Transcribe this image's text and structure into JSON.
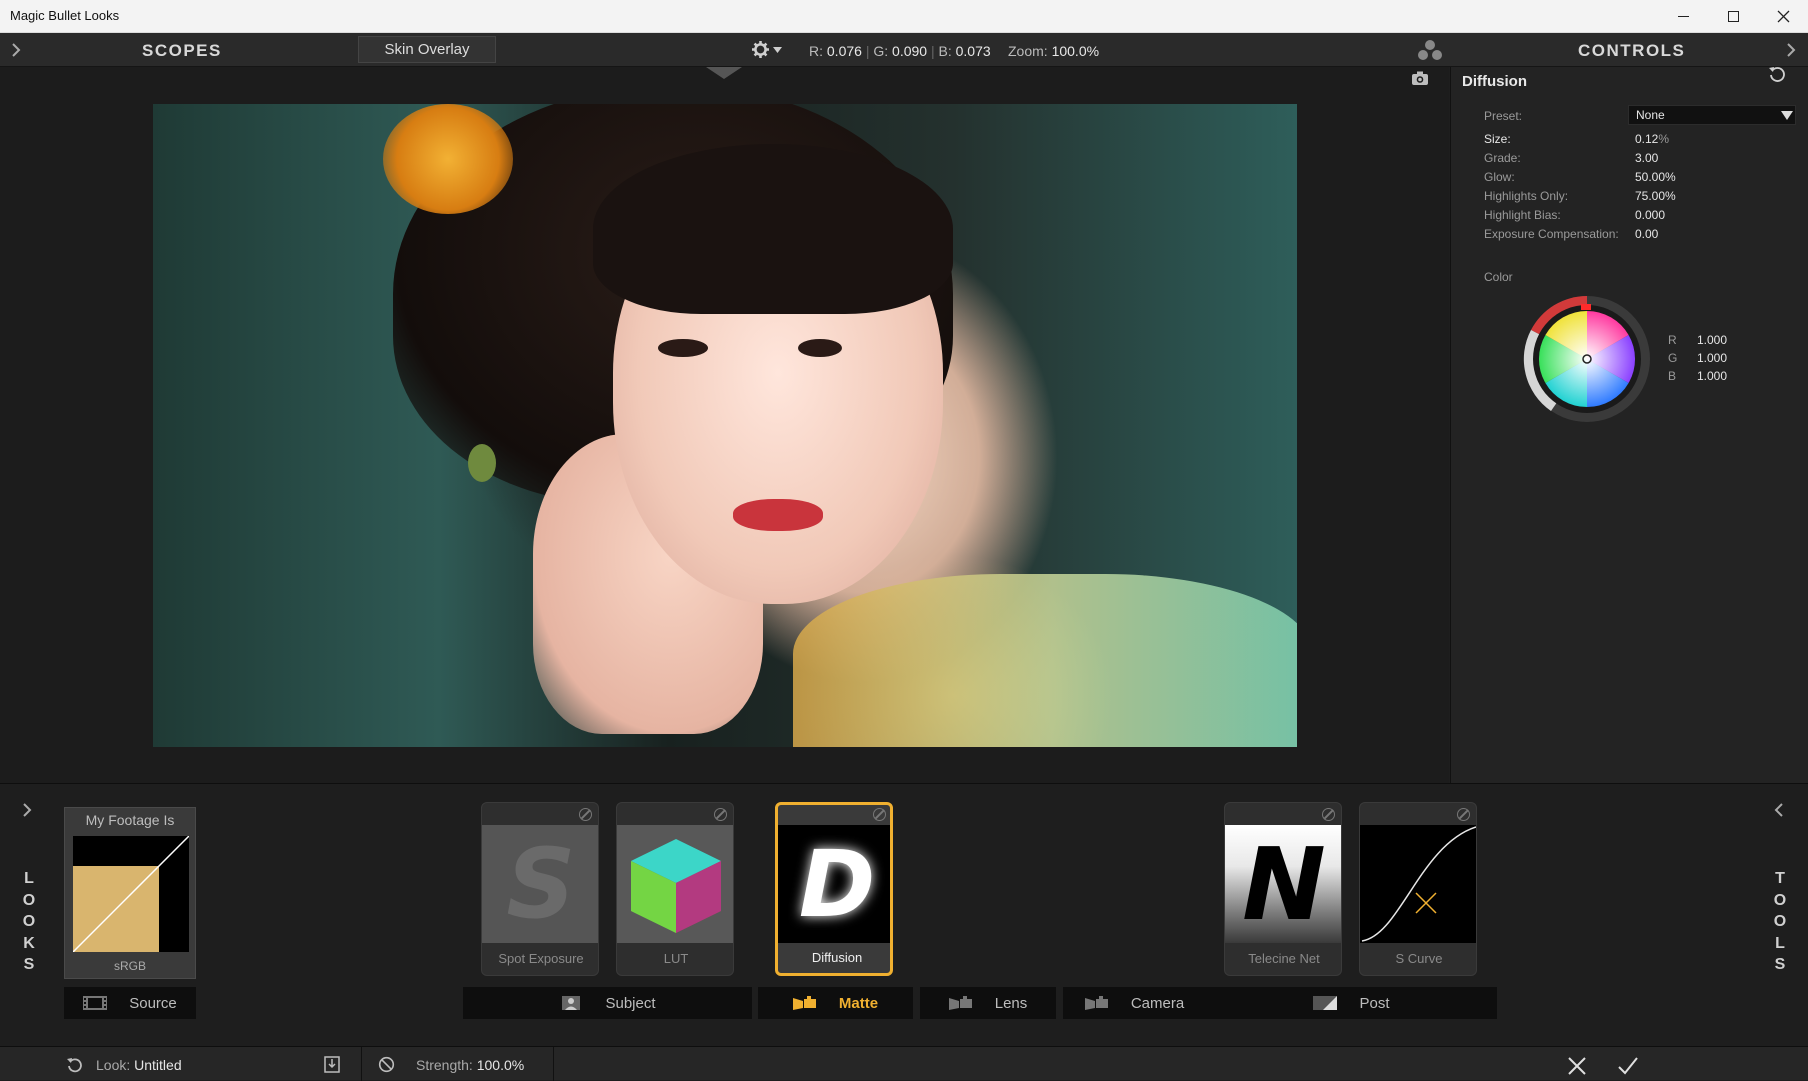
{
  "window": {
    "title": "Magic Bullet Looks"
  },
  "header": {
    "scopes_label": "SCOPES",
    "skin_overlay_label": "Skin Overlay",
    "readout": {
      "r_label": "R:",
      "r": "0.076",
      "g_label": "G:",
      "g": "0.090",
      "b_label": "B:",
      "b": "0.073",
      "zoom_label": "Zoom:",
      "zoom": "100.0%"
    },
    "controls_label": "CONTROLS"
  },
  "controls": {
    "tool_name": "Diffusion",
    "preset_label": "Preset:",
    "preset_value": "None",
    "params": [
      {
        "label": "Size:",
        "value": "0.12",
        "unit": "%"
      },
      {
        "label": "Grade:",
        "value": "3.00",
        "unit": ""
      },
      {
        "label": "Glow:",
        "value": "50.00%",
        "unit": ""
      },
      {
        "label": "Highlights Only:",
        "value": "75.00%",
        "unit": ""
      },
      {
        "label": "Highlight Bias:",
        "value": "0.000",
        "unit": ""
      },
      {
        "label": "Exposure Compensation:",
        "value": "0.00",
        "unit": ""
      }
    ],
    "color_label": "Color",
    "rgb": [
      {
        "ch": "R",
        "value": "1.000"
      },
      {
        "ch": "G",
        "value": "1.000"
      },
      {
        "ch": "B",
        "value": "1.000"
      }
    ]
  },
  "looks_label": [
    "L",
    "O",
    "O",
    "K",
    "S"
  ],
  "tools_label": [
    "T",
    "O",
    "O",
    "L",
    "S"
  ],
  "source": {
    "header": "My Footage Is",
    "colorspace": "sRGB",
    "tab_label": "Source"
  },
  "tools": [
    {
      "name": "Spot Exposure"
    },
    {
      "name": "LUT"
    },
    {
      "name": "Diffusion"
    },
    {
      "name": "Telecine Net"
    },
    {
      "name": "S Curve"
    }
  ],
  "tabs": {
    "subject": "Subject",
    "matte": "Matte",
    "lens": "Lens",
    "camera": "Camera",
    "post": "Post"
  },
  "status": {
    "look_label": "Look:",
    "look_value": "Untitled",
    "strength_label": "Strength:",
    "strength_value": "100.0%"
  },
  "colors": {
    "accent": "#f0b030",
    "bg": "#1e1e1e",
    "panel": "#232323"
  }
}
